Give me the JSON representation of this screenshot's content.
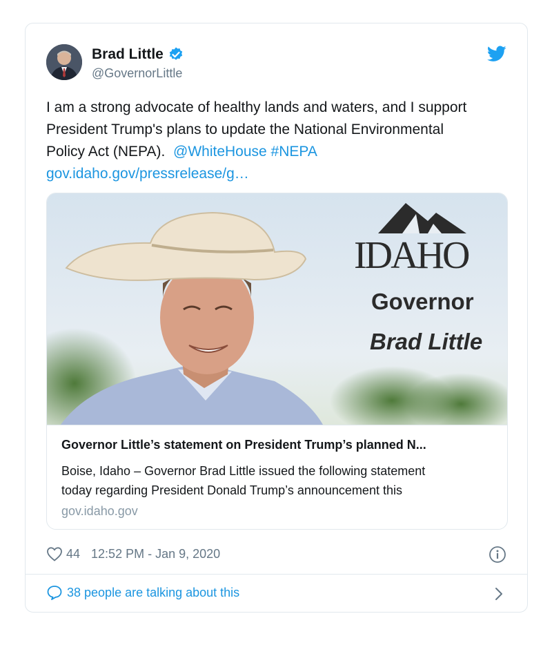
{
  "author": {
    "name": "Brad Little",
    "handle": "@GovernorLittle"
  },
  "tweet": {
    "text_line1": "I am a strong advocate of healthy lands and waters, and I support",
    "text_line2": "President Trump's plans to update the National Environmental",
    "text_line3": "Policy Act (NEPA).",
    "mention": "@WhiteHouse",
    "hashtag": "#NEPA",
    "url": "gov.idaho.gov/pressrelease/g…"
  },
  "card": {
    "image_brand": "IDAHO",
    "image_title": "Governor",
    "image_name": "Brad Little",
    "title": "Governor Little’s statement on President Trump’s planned N...",
    "desc_line1": "Boise, Idaho – Governor Brad Little issued the following statement",
    "desc_line2": "today regarding President Donald Trump’s announcement this",
    "domain": "gov.idaho.gov"
  },
  "meta": {
    "likes": "44",
    "timestamp": "12:52 PM - Jan 9, 2020"
  },
  "footer": {
    "talking": "38 people are talking about this"
  },
  "colors": {
    "link": "#1b95e0",
    "secondary": "#657786",
    "border": "#e1e8ed"
  },
  "icons": [
    "avatar",
    "verified-badge-icon",
    "twitter-bird-icon",
    "heart-icon",
    "info-icon",
    "speech-bubble-icon",
    "chevron-right-icon"
  ]
}
